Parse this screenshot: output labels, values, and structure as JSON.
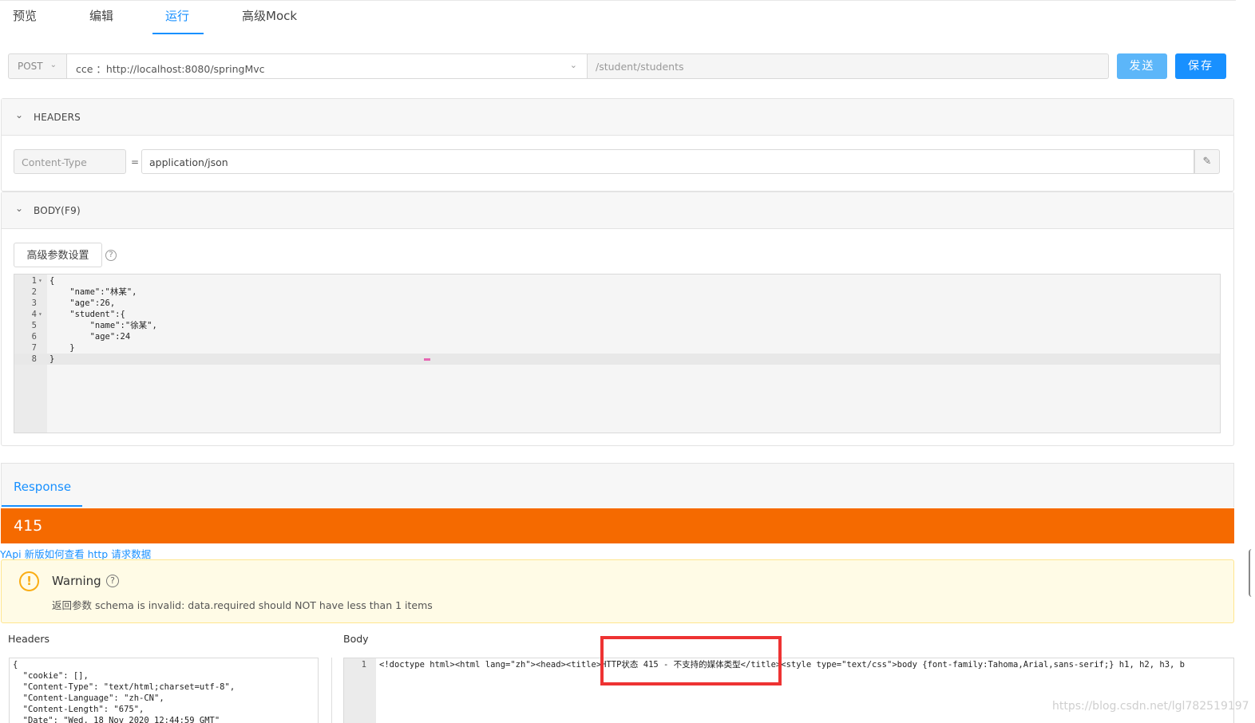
{
  "tabs": [
    "预览",
    "编辑",
    "运行",
    "高级Mock"
  ],
  "active_tab": "运行",
  "request": {
    "method": "POST",
    "domain": "cce ：http://localhost:8080/springMvc",
    "path": "/student/students",
    "send_label": "发送",
    "save_label": "保存"
  },
  "headers_section": {
    "title": "HEADERS",
    "key": "Content-Type",
    "eq": "=",
    "value": "application/json",
    "edit_icon": "✎"
  },
  "body_section": {
    "title": "BODY(F9)",
    "advanced_label": "高级参数设置",
    "help_icon": "?",
    "code_lines": [
      "{",
      "    \"name\":\"林某\",",
      "    \"age\":26,",
      "    \"student\":{",
      "        \"name\":\"徐某\",",
      "        \"age\":24",
      "    }",
      "}"
    ]
  },
  "response": {
    "tab_label": "Response",
    "status_code": "415",
    "help_link": "YApi 新版如何查看 http 请求数据",
    "warning_title": "Warning",
    "warning_desc": "返回参数 schema is invalid: data.required should NOT have less than 1 items",
    "headers_title": "Headers",
    "body_title": "Body",
    "headers_lines": [
      "{",
      "  \"cookie\": [],",
      "  \"Content-Type\": \"text/html;charset=utf-8\",",
      "  \"Content-Language\": \"zh-CN\",",
      "  \"Content-Length\": \"675\",",
      "  \"Date\": \"Wed, 18 Nov 2020 12:44:59 GMT\""
    ],
    "body_line_number": "1",
    "body_code": "<!doctype html><html lang=\"zh\"><head><title>HTTP状态 415 - 不支持的媒体类型</title><style type=\"text/css\">body {font-family:Tahoma,Arial,sans-serif;} h1, h2, h3, b"
  },
  "watermark": "https://blog.csdn.net/lgl782519197",
  "colors": {
    "accent": "#1890ff",
    "status_bar": "#f56a00",
    "warning_bg": "#fffbe6",
    "highlight_border": "#e33333"
  }
}
